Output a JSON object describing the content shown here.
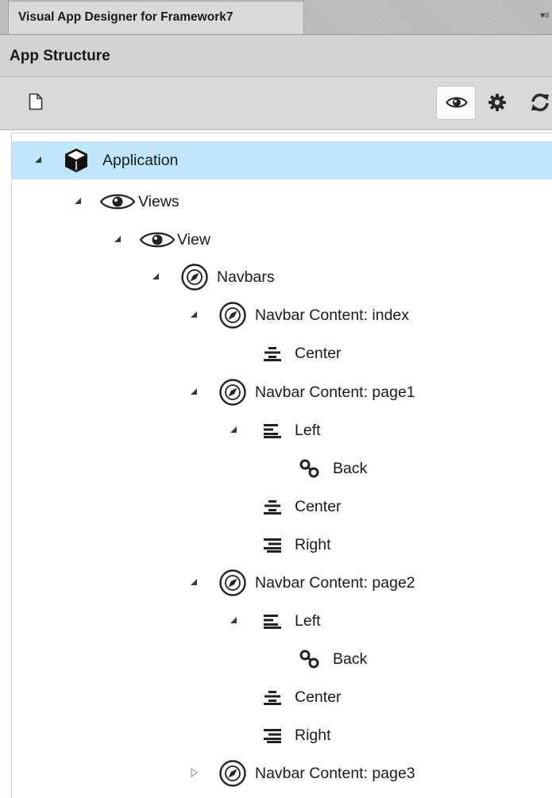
{
  "panel": {
    "tab_title": "Visual App Designer for Framework7",
    "panel_menu_glyph": "▾≡",
    "title": "App Structure"
  },
  "toolbar": {
    "new_icon": "new-document-icon",
    "eye_icon": "eye-icon",
    "gear_icon": "gear-icon",
    "refresh_icon": "refresh-icon"
  },
  "colors": {
    "selected_row": "#bfe6fb",
    "tab_bar": "#b8b8b8",
    "header": "#d3d3d3"
  },
  "tree": [
    {
      "label": "Application",
      "icon": "cube-icon",
      "state": "expanded",
      "selected": true
    },
    {
      "label": "Views",
      "icon": "eye-icon",
      "state": "expanded"
    },
    {
      "label": "View",
      "icon": "eye-icon",
      "state": "expanded"
    },
    {
      "label": "Navbars",
      "icon": "compass-icon",
      "state": "expanded"
    },
    {
      "label": "Navbar Content: index",
      "icon": "compass-icon",
      "state": "expanded"
    },
    {
      "label": "Center",
      "icon": "align-center-icon",
      "state": "leaf"
    },
    {
      "label": "Navbar Content: page1",
      "icon": "compass-icon",
      "state": "expanded"
    },
    {
      "label": "Left",
      "icon": "align-left-icon",
      "state": "expanded"
    },
    {
      "label": "Back",
      "icon": "link-icon",
      "state": "leaf"
    },
    {
      "label": "Center",
      "icon": "align-center-icon",
      "state": "leaf"
    },
    {
      "label": "Right",
      "icon": "align-right-icon",
      "state": "leaf"
    },
    {
      "label": "Navbar Content: page2",
      "icon": "compass-icon",
      "state": "expanded"
    },
    {
      "label": "Left",
      "icon": "align-left-icon",
      "state": "expanded"
    },
    {
      "label": "Back",
      "icon": "link-icon",
      "state": "leaf"
    },
    {
      "label": "Center",
      "icon": "align-center-icon",
      "state": "leaf"
    },
    {
      "label": "Right",
      "icon": "align-right-icon",
      "state": "leaf"
    },
    {
      "label": "Navbar Content: page3",
      "icon": "compass-icon",
      "state": "collapsed"
    },
    {
      "label": "",
      "icon": "compass-icon",
      "state": "leaf"
    }
  ]
}
